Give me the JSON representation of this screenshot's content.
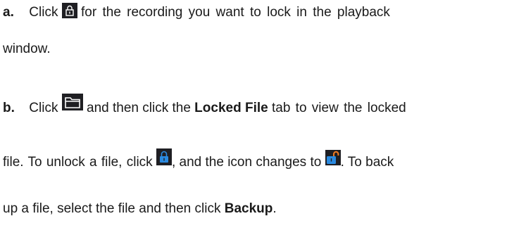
{
  "step_a": {
    "letter": "a.",
    "text_before_icon": "Click",
    "lock_icon": "lock-icon",
    "text_after_icon": "for the recording you want to lock in the playback",
    "continuation": "window."
  },
  "step_b": {
    "letter": "b.",
    "text_before_icon": "Click",
    "folder_icon": "folder-icon",
    "text_after_icon": "and then click the",
    "locked_file_label": "Locked File",
    "text_after_label": "tab to view the locked",
    "line2_part1": "file. To unlock a file, click",
    "locked_icon": "locked-icon",
    "line2_part2": ", and the icon changes to",
    "unlocked_icon": "unlocked-icon",
    "line2_part3": ". To back",
    "line3_part1": "up a file, select the file and then click",
    "backup_label": "Backup",
    "line3_part2": "."
  },
  "colors": {
    "text": "#1a1a1a",
    "icon_dark_bg": "#1f1f23",
    "icon_blue": "#2a8ae0",
    "icon_unlocked_orange": "#f07a22"
  }
}
